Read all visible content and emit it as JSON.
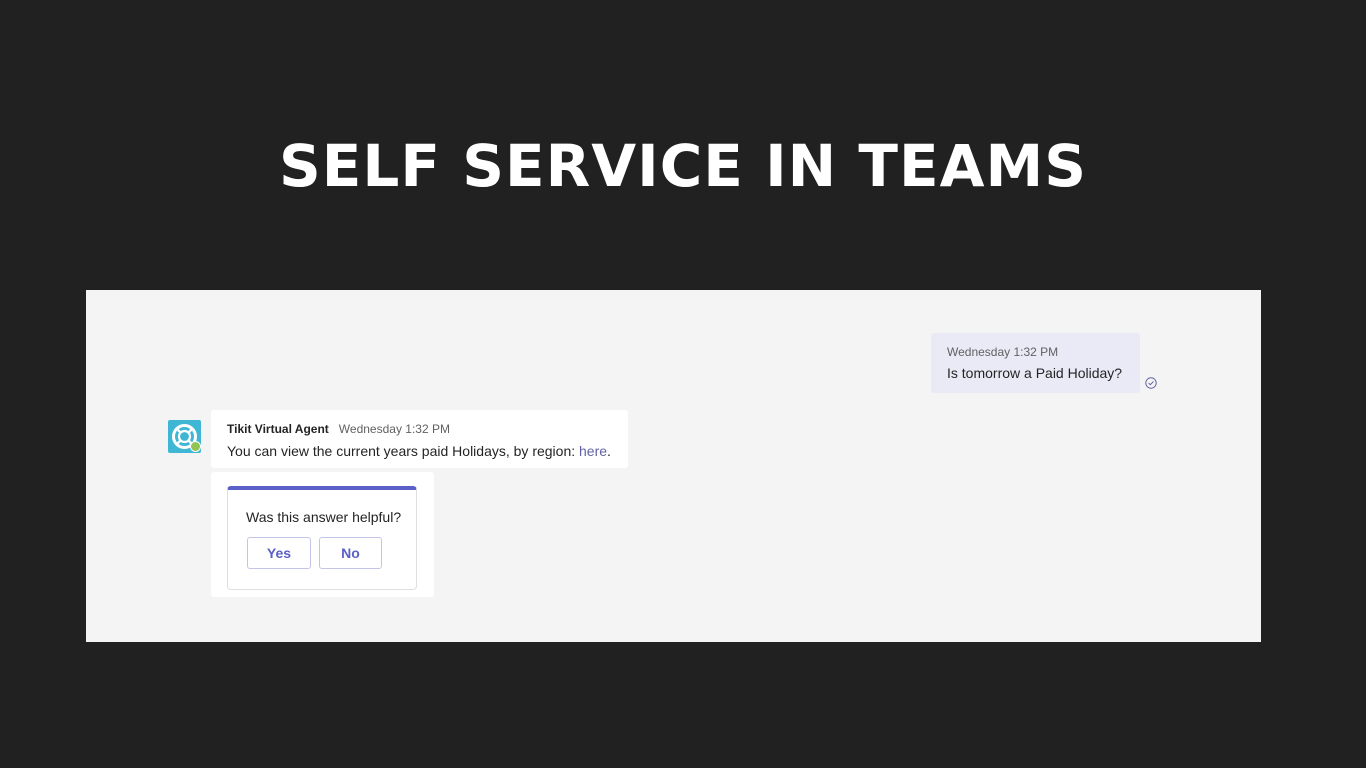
{
  "slide": {
    "title": "SELF SERVICE IN TEAMS"
  },
  "colors": {
    "background": "#212121",
    "panel": "#f4f4f4",
    "accent": "#5b5fc7",
    "outgoing_bubble": "#e9eaf6",
    "avatar": "#3fb6d3",
    "status": "#92c353"
  },
  "chat": {
    "outgoing": {
      "timestamp": "Wednesday 1:32 PM",
      "text": "Is tomorrow a Paid Holiday?",
      "status_icon": "read-receipt-check-icon"
    },
    "incoming": {
      "sender": "Tikit Virtual Agent",
      "timestamp": "Wednesday 1:32 PM",
      "text": "You can view the current years paid Holidays, by region: ",
      "link_text": "here",
      "trailing": ".",
      "avatar_icon": "lifebuoy-icon"
    },
    "feedback_card": {
      "question": "Was this answer helpful?",
      "yes_label": "Yes",
      "no_label": "No"
    }
  }
}
